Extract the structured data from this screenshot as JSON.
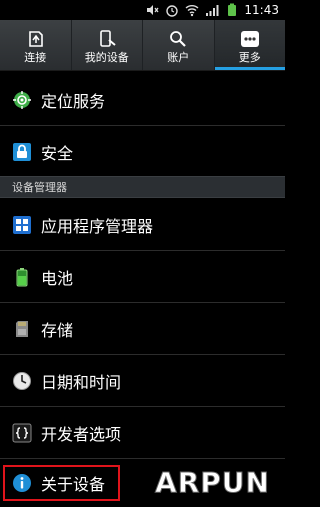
{
  "status_bar": {
    "time": "11:43"
  },
  "tabs": [
    {
      "label": "连接",
      "icon": "connections-icon",
      "active": false
    },
    {
      "label": "我的设备",
      "icon": "my-device-icon",
      "active": false
    },
    {
      "label": "账户",
      "icon": "accounts-icon",
      "active": false
    },
    {
      "label": "更多",
      "icon": "more-icon",
      "active": true
    }
  ],
  "items_top": [
    {
      "label": "定位服务",
      "icon": "location-icon"
    },
    {
      "label": "安全",
      "icon": "lock-icon"
    }
  ],
  "section_header": "设备管理器",
  "items_device": [
    {
      "label": "应用程序管理器",
      "icon": "app-grid-icon"
    },
    {
      "label": "电池",
      "icon": "battery-icon"
    },
    {
      "label": "存储",
      "icon": "sd-card-icon"
    },
    {
      "label": "日期和时间",
      "icon": "clock-icon"
    },
    {
      "label": "开发者选项",
      "icon": "developer-braces-icon"
    },
    {
      "label": "关于设备",
      "icon": "info-icon"
    }
  ],
  "watermark": "ARPUN",
  "colors": {
    "accent": "#25a0e3",
    "highlight_border": "#e0141b",
    "background": "#000000"
  }
}
